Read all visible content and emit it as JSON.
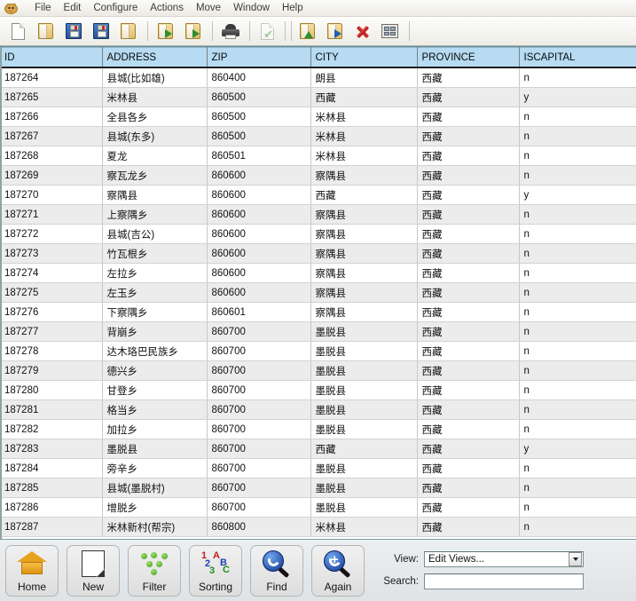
{
  "app": {
    "icon": "app-icon"
  },
  "menubar": {
    "items": [
      {
        "label": "File"
      },
      {
        "label": "Edit"
      },
      {
        "label": "Configure"
      },
      {
        "label": "Actions"
      },
      {
        "label": "Move"
      },
      {
        "label": "Window"
      },
      {
        "label": "Help"
      }
    ]
  },
  "toolbar": {
    "buttons": [
      {
        "name": "new-document-icon"
      },
      {
        "name": "open-folder-icon"
      },
      {
        "name": "save-icon"
      },
      {
        "name": "save-as-icon"
      },
      {
        "name": "folder-icon"
      },
      {
        "name": "import-folder-icon"
      },
      {
        "name": "export-file-icon"
      },
      {
        "name": "print-icon"
      },
      {
        "name": "validate-document-icon"
      },
      {
        "name": "insert-record-icon"
      },
      {
        "name": "commit-record-icon"
      },
      {
        "name": "delete-record-icon"
      },
      {
        "name": "table-view-icon"
      }
    ]
  },
  "table": {
    "columns": [
      "ID",
      "ADDRESS",
      "ZIP",
      "CITY",
      "PROVINCE",
      "ISCAPITAL"
    ],
    "rows": [
      [
        "187264",
        "县城(比如雄)",
        "860400",
        "朗县",
        "西藏",
        "n"
      ],
      [
        "187265",
        "米林县",
        "860500",
        "西藏",
        "西藏",
        "y"
      ],
      [
        "187266",
        "全县各乡",
        "860500",
        "米林县",
        "西藏",
        "n"
      ],
      [
        "187267",
        "县城(东多)",
        "860500",
        "米林县",
        "西藏",
        "n"
      ],
      [
        "187268",
        "夏龙",
        "860501",
        "米林县",
        "西藏",
        "n"
      ],
      [
        "187269",
        "察瓦龙乡",
        "860600",
        "察隅县",
        "西藏",
        "n"
      ],
      [
        "187270",
        "察隅县",
        "860600",
        "西藏",
        "西藏",
        "y"
      ],
      [
        "187271",
        "上察隅乡",
        "860600",
        "察隅县",
        "西藏",
        "n"
      ],
      [
        "187272",
        "县城(吉公)",
        "860600",
        "察隅县",
        "西藏",
        "n"
      ],
      [
        "187273",
        "竹瓦根乡",
        "860600",
        "察隅县",
        "西藏",
        "n"
      ],
      [
        "187274",
        "左拉乡",
        "860600",
        "察隅县",
        "西藏",
        "n"
      ],
      [
        "187275",
        "左玉乡",
        "860600",
        "察隅县",
        "西藏",
        "n"
      ],
      [
        "187276",
        "下察隅乡",
        "860601",
        "察隅县",
        "西藏",
        "n"
      ],
      [
        "187277",
        "背崩乡",
        "860700",
        "墨脱县",
        "西藏",
        "n"
      ],
      [
        "187278",
        "达木珞巴民族乡",
        "860700",
        "墨脱县",
        "西藏",
        "n"
      ],
      [
        "187279",
        "德兴乡",
        "860700",
        "墨脱县",
        "西藏",
        "n"
      ],
      [
        "187280",
        "甘登乡",
        "860700",
        "墨脱县",
        "西藏",
        "n"
      ],
      [
        "187281",
        "格当乡",
        "860700",
        "墨脱县",
        "西藏",
        "n"
      ],
      [
        "187282",
        "加拉乡",
        "860700",
        "墨脱县",
        "西藏",
        "n"
      ],
      [
        "187283",
        "墨脱县",
        "860700",
        "西藏",
        "西藏",
        "y"
      ],
      [
        "187284",
        "旁辛乡",
        "860700",
        "墨脱县",
        "西藏",
        "n"
      ],
      [
        "187285",
        "县城(墨脱村)",
        "860700",
        "墨脱县",
        "西藏",
        "n"
      ],
      [
        "187286",
        "增脱乡",
        "860700",
        "墨脱县",
        "西藏",
        "n"
      ],
      [
        "187287",
        "米林新村(帮宗)",
        "860800",
        "米林县",
        "西藏",
        "n"
      ]
    ]
  },
  "bottombar": {
    "buttons": [
      {
        "label": "Home",
        "icon": "home-icon"
      },
      {
        "label": "New",
        "icon": "new-page-icon"
      },
      {
        "label": "Filter",
        "icon": "filter-dots-icon"
      },
      {
        "label": "Sorting",
        "icon": "sorting-abc123-icon"
      },
      {
        "label": "Find",
        "icon": "magnifier-icon"
      },
      {
        "label": "Again",
        "icon": "magnifier-plus-icon"
      }
    ],
    "view": {
      "label": "View:",
      "value": "Edit Views..."
    },
    "search": {
      "label": "Search:",
      "value": "",
      "placeholder": ""
    }
  },
  "colors": {
    "header_bg": "#b6dbf2",
    "row_alt_bg": "#ececec",
    "row_bg": "#ffffff",
    "accent": "#24529b"
  }
}
